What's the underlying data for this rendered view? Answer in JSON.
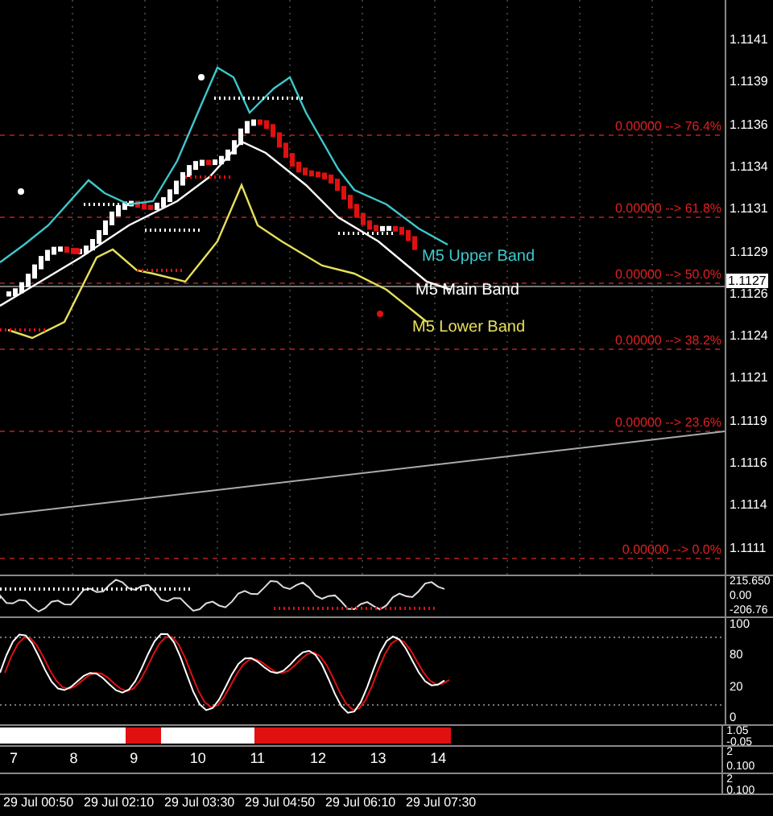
{
  "price_chart": {
    "band_labels": [
      {
        "text": "M5 Upper Band",
        "color": "#3ec8cc"
      },
      {
        "text": "M5 Main Band",
        "color": "#ffffff"
      },
      {
        "text": "M5 Lower Band",
        "color": "#e6e05a"
      }
    ],
    "fib_levels": [
      {
        "label": "0.00000 --> 76.4%"
      },
      {
        "label": "0.00000 --> 61.8%"
      },
      {
        "label": "0.00000 --> 50.0%"
      },
      {
        "label": "0.00000 --> 38.2%"
      },
      {
        "label": "0.00000 --> 23.6%"
      },
      {
        "label": "0.00000 --> 0.0%"
      }
    ],
    "price_axis": [
      {
        "text": "1.1141",
        "kind": "tick"
      },
      {
        "text": "1.1139",
        "kind": "tick"
      },
      {
        "text": "1.1136",
        "kind": "tick"
      },
      {
        "text": "1.1134",
        "kind": "tick"
      },
      {
        "text": "1.1131",
        "kind": "tick"
      },
      {
        "text": "1.1129",
        "kind": "tick"
      },
      {
        "text": "1.1127",
        "kind": "current"
      },
      {
        "text": "1.1126",
        "kind": "tick"
      },
      {
        "text": "1.1124",
        "kind": "tick"
      },
      {
        "text": "1.1121",
        "kind": "tick"
      },
      {
        "text": "1.1119",
        "kind": "tick"
      },
      {
        "text": "1.1116",
        "kind": "tick"
      },
      {
        "text": "1.1114",
        "kind": "tick"
      },
      {
        "text": "1.1111",
        "kind": "tick"
      }
    ]
  },
  "cci_panel": {
    "axis": [
      "215.650",
      "0.00",
      "-206.76"
    ]
  },
  "stochastic_panel": {
    "axis": [
      "100",
      "80",
      "20",
      "0"
    ]
  },
  "session_panel": {
    "axis": [
      "1.05",
      "-0.05"
    ]
  },
  "hour_panel": {
    "hours": [
      "7",
      "8",
      "9",
      "10",
      "11",
      "12",
      "13",
      "14"
    ],
    "axis": [
      "2",
      "0.100"
    ]
  },
  "lower_panel": {
    "axis": [
      "2",
      "0.100"
    ]
  },
  "time_axis": [
    "29 Jul 00:50",
    "29 Jul 02:10",
    "29 Jul 03:30",
    "29 Jul 04:50",
    "29 Jul 06:10",
    "29 Jul 07:30"
  ]
}
